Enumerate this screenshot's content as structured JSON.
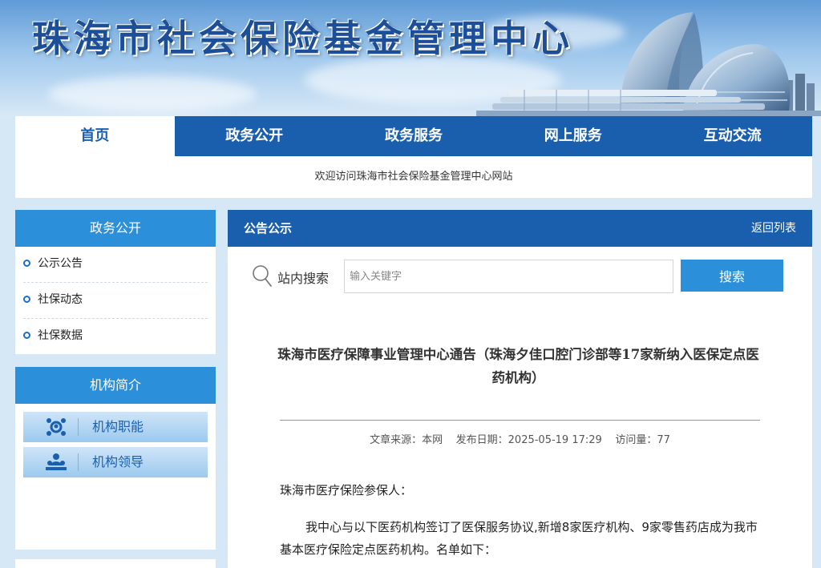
{
  "header": {
    "site_title": "珠海市社会保险基金管理中心"
  },
  "nav": {
    "items": [
      {
        "label": "首页"
      },
      {
        "label": "政务公开"
      },
      {
        "label": "政务服务"
      },
      {
        "label": "网上服务"
      },
      {
        "label": "互动交流"
      }
    ],
    "welcome": "欢迎访问珠海市社会保险基金管理中心网站"
  },
  "sidebar": {
    "section1": {
      "title": "政务公开",
      "items": [
        {
          "label": "公示公告"
        },
        {
          "label": "社保动态"
        },
        {
          "label": "社保数据"
        }
      ]
    },
    "section2": {
      "title": "机构简介",
      "buttons": [
        {
          "label": "机构职能",
          "icon": "people-network-icon"
        },
        {
          "label": "机构领导",
          "icon": "people-group-icon"
        }
      ]
    }
  },
  "main": {
    "section_title": "公告公示",
    "back_link": "返回列表",
    "search": {
      "label": "站内搜索",
      "placeholder": "输入关键字",
      "button": "搜索"
    },
    "article": {
      "title": "珠海市医疗保障事业管理中心通告（珠海夕佳口腔门诊部等17家新纳入医保定点医药机构）",
      "meta": {
        "source_label": "文章来源：",
        "source": "本网",
        "date_label": "发布日期：",
        "date": "2025-05-19 17:29",
        "views_label": "访问量：",
        "views": "77"
      },
      "greeting": "珠海市医疗保险参保人：",
      "paragraph1": "我中心与以下医药机构签订了医保服务协议,新增8家医疗机构、9家零售药店成为我市基本医疗保险定点医药机构。名单如下："
    }
  },
  "colors": {
    "primary": "#1a5fae",
    "accent": "#2b8fd9",
    "title": "#1d4f98"
  }
}
